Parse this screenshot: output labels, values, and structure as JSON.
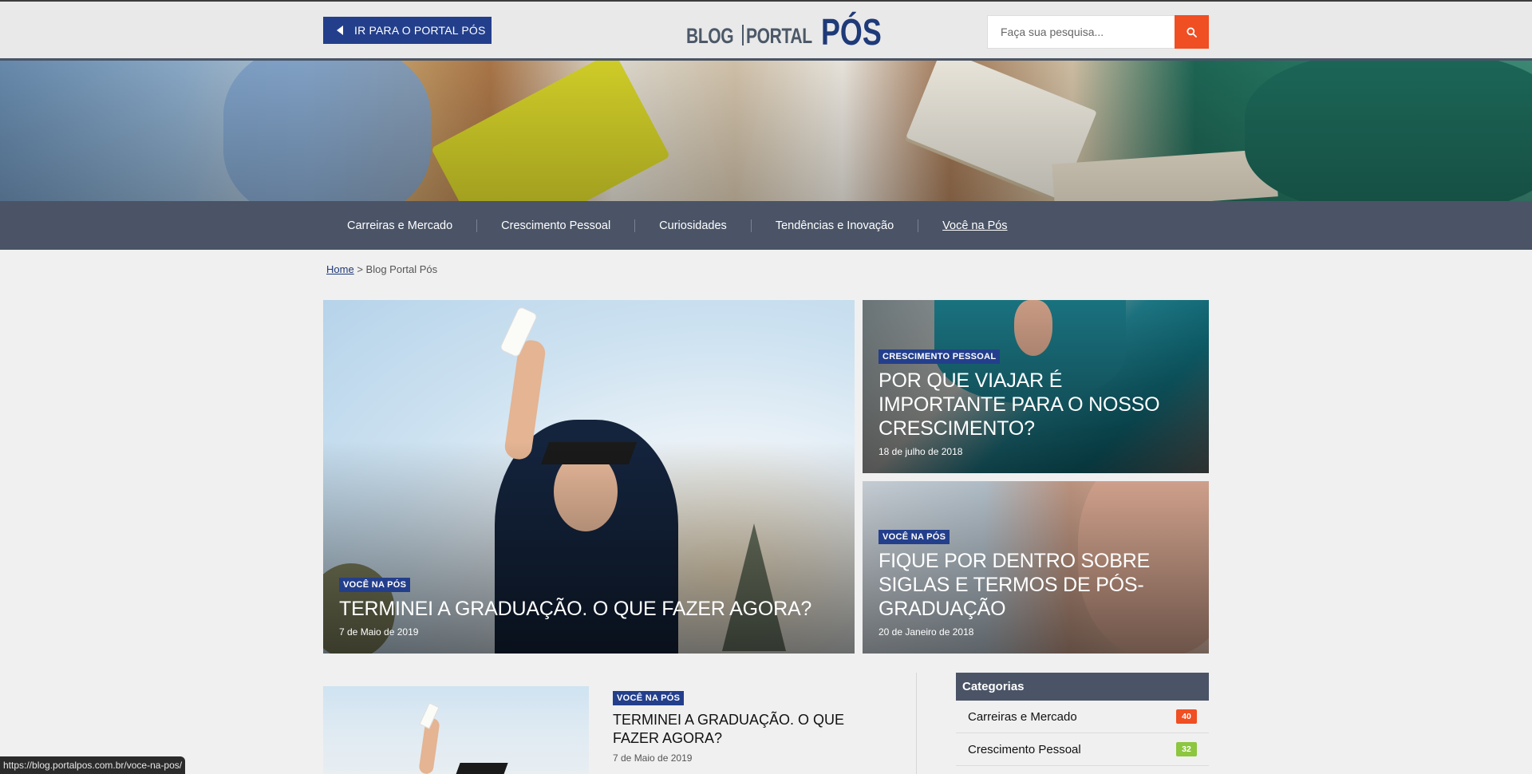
{
  "header": {
    "portal_button_label": "IR PARA O PORTAL PÓS",
    "logo": {
      "part1": "BLOG",
      "part2": "PORTAL",
      "part3": "PÓS"
    },
    "search": {
      "placeholder": "Faça sua pesquisa...",
      "value": ""
    }
  },
  "nav": {
    "items": [
      {
        "label": "Carreiras e Mercado"
      },
      {
        "label": "Crescimento Pessoal"
      },
      {
        "label": "Curiosidades"
      },
      {
        "label": "Tendências e Inovação"
      },
      {
        "label": "Você na Pós"
      }
    ],
    "active_index": 4
  },
  "breadcrumb": {
    "home": "Home",
    "separator": ">",
    "current": "Blog Portal Pós"
  },
  "featured": {
    "main": {
      "badge": "VOCÊ NA PÓS",
      "title": "TERMINEI A GRADUAÇÃO. O QUE FAZER AGORA?",
      "date": "7 de Maio de 2019"
    },
    "side": [
      {
        "badge": "CRESCIMENTO PESSOAL",
        "title": "POR QUE VIAJAR É IMPORTANTE PARA O NOSSO CRESCIMENTO?",
        "date": "18 de julho de 2018"
      },
      {
        "badge": "VOCÊ NA PÓS",
        "title": "FIQUE POR DENTRO SOBRE SIGLAS E TERMOS DE PÓS-GRADUAÇÃO",
        "date": "20 de Janeiro de 2018"
      }
    ]
  },
  "posts": [
    {
      "badge": "VOCÊ NA PÓS",
      "title": "TERMINEI A GRADUAÇÃO. O QUE FAZER AGORA?",
      "date": "7 de Maio de 2019"
    }
  ],
  "sidebar": {
    "title": "Categorias",
    "categories": [
      {
        "name": "Carreiras e Mercado",
        "count": "40",
        "color": "#f04e23"
      },
      {
        "name": "Crescimento Pessoal",
        "count": "32",
        "color": "#8dc63f"
      }
    ]
  },
  "status_url": "https://blog.portalpos.com.br/voce-na-pos/",
  "colors": {
    "brand_blue": "#233f8c",
    "nav_bg": "#4a5466",
    "accent_orange": "#f04e23"
  }
}
